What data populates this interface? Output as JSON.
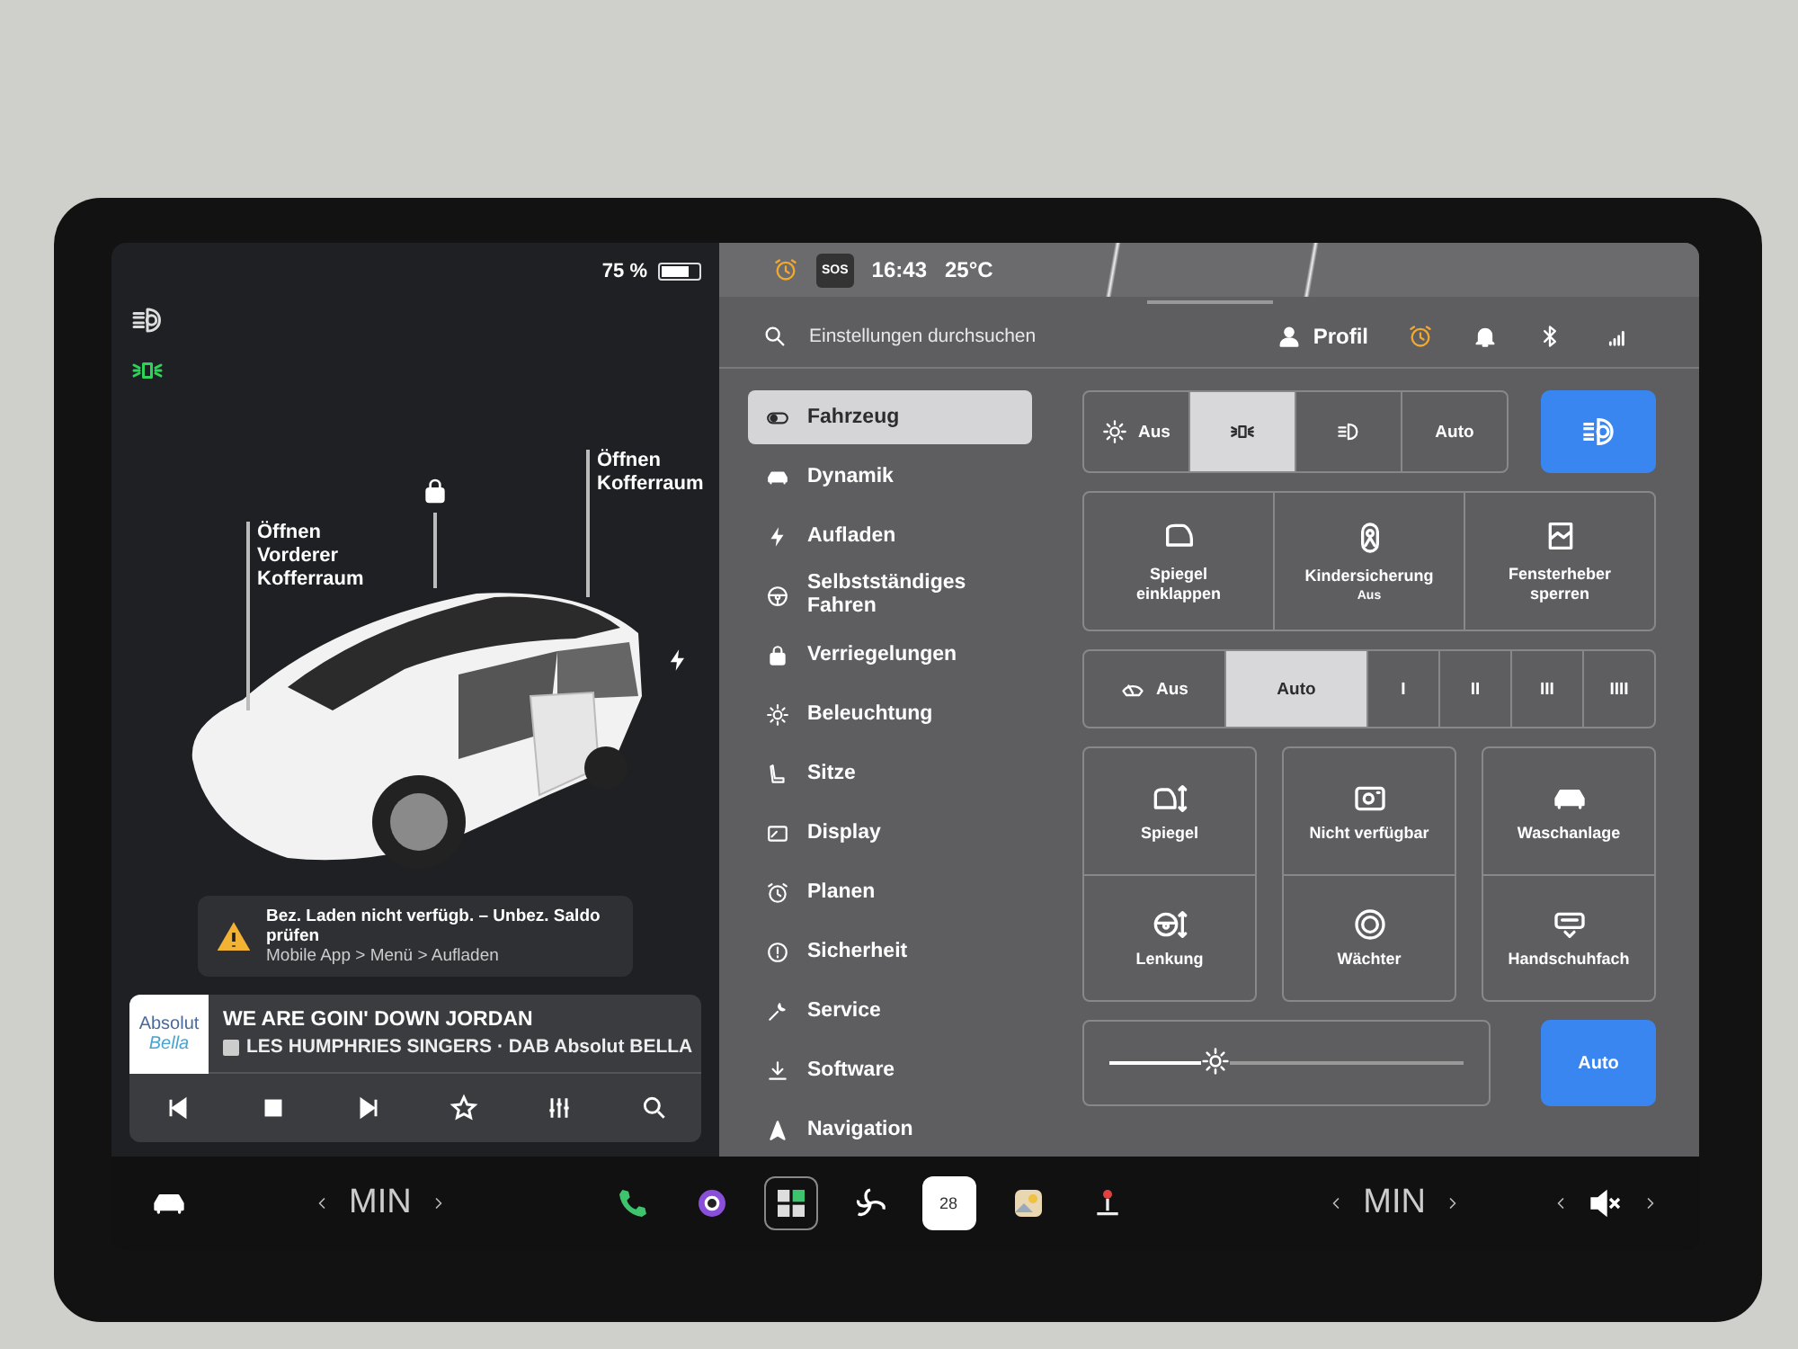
{
  "left_panel": {
    "battery": "75 %",
    "car_labels": [
      {
        "text": "Öffnen Vorderer Kofferraum",
        "kind": "frunk"
      },
      {
        "text": "Öffnen Kofferraum",
        "kind": "trunk"
      }
    ],
    "alert": {
      "title": "Bez. Laden nicht verfügb. – Unbez. Saldo prüfen",
      "path": "Mobile App > Menü > Aufladen"
    },
    "media": {
      "logo_lines": [
        "Absolut",
        "Bella"
      ],
      "title": "WE ARE GOIN' DOWN JORDAN",
      "subtitle": "LES HUMPHRIES SINGERS · DAB Absolut BELLA"
    }
  },
  "status_bar": {
    "sos": "SOS",
    "time": "16:43",
    "temperature": "25°C"
  },
  "search": {
    "placeholder": "Einstellungen durchsuchen"
  },
  "profile": {
    "label": "Profil"
  },
  "menu": [
    {
      "label": "Fahrzeug",
      "kind": "toggle",
      "selected": true
    },
    {
      "label": "Dynamik",
      "kind": "car",
      "selected": false
    },
    {
      "label": "Aufladen",
      "kind": "bolt",
      "selected": false
    },
    {
      "label": "Selbstständiges Fahren",
      "kind": "wheel",
      "selected": false
    },
    {
      "label": "Verriegelungen",
      "kind": "lock",
      "selected": false
    },
    {
      "label": "Beleuchtung",
      "kind": "sun",
      "selected": false
    },
    {
      "label": "Sitze",
      "kind": "seat",
      "selected": false
    },
    {
      "label": "Display",
      "kind": "display",
      "selected": false
    },
    {
      "label": "Planen",
      "kind": "alarm",
      "selected": false
    },
    {
      "label": "Sicherheit",
      "kind": "info",
      "selected": false
    },
    {
      "label": "Service",
      "kind": "wrench",
      "selected": false
    },
    {
      "label": "Software",
      "kind": "download",
      "selected": false
    },
    {
      "label": "Navigation",
      "kind": "nav",
      "selected": false
    }
  ],
  "light_modes": [
    {
      "label": "Aus",
      "kind": "sun",
      "selected": false
    },
    {
      "kind": "parklight",
      "selected": true
    },
    {
      "kind": "lowbeam",
      "selected": false
    },
    {
      "label": "Auto",
      "kind": "text",
      "selected": false
    }
  ],
  "auto_high_beam": {
    "on": true
  },
  "tiles": [
    {
      "label": "Spiegel einklappen",
      "kind": "mirror"
    },
    {
      "label": "Kindersicherung",
      "sublabel": "Aus",
      "kind": "child"
    },
    {
      "label": "Fensterheber sperren",
      "kind": "window"
    }
  ],
  "wiper_modes": [
    {
      "label": "Aus",
      "kind": "wiper",
      "selected": false
    },
    {
      "label": "Auto",
      "kind": "text",
      "selected": true
    },
    {
      "label": "I",
      "kind": "text",
      "selected": false
    },
    {
      "label": "II",
      "kind": "text",
      "selected": false
    },
    {
      "label": "III",
      "kind": "text",
      "selected": false
    },
    {
      "label": "IIII",
      "kind": "text",
      "selected": false
    }
  ],
  "tile_groups": [
    [
      {
        "label": "Spiegel",
        "kind": "mirror-adjust"
      },
      {
        "label": "Lenkung",
        "kind": "wheel-adjust"
      }
    ],
    [
      {
        "label": "Nicht verfügbar",
        "kind": "camera"
      },
      {
        "label": "Wächter",
        "kind": "target"
      }
    ],
    [
      {
        "label": "Waschanlage",
        "kind": "car"
      },
      {
        "label": "Handschuhfach",
        "kind": "glovebox"
      }
    ]
  ],
  "brightness": {
    "level": 0.3,
    "auto_on": true,
    "auto_label": "Auto"
  },
  "dock": {
    "left_temp": "MIN",
    "right_temp": "MIN",
    "calendar_day": "28"
  }
}
